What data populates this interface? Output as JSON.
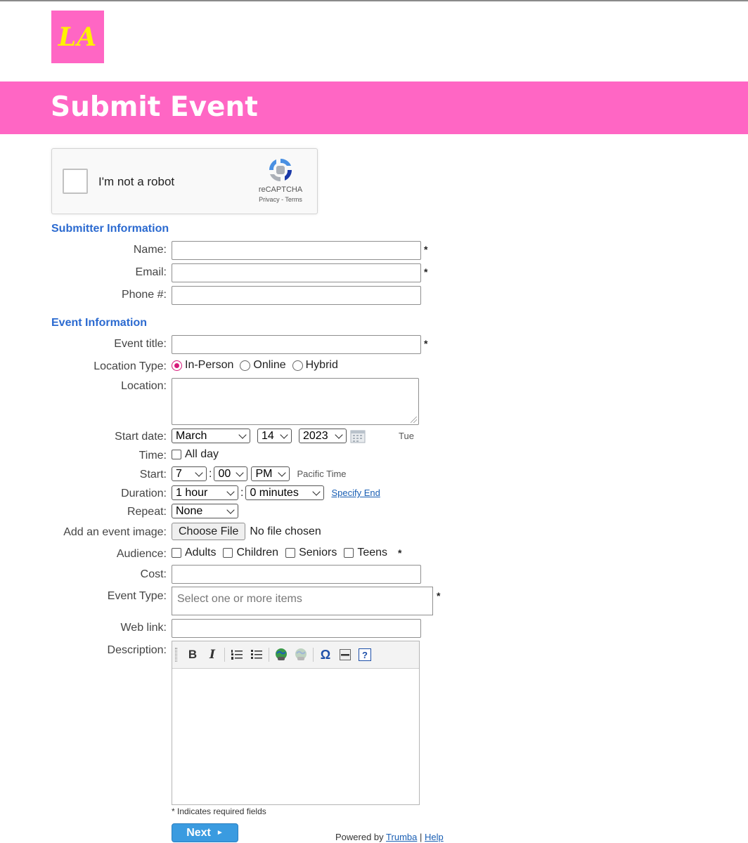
{
  "logo": {
    "text": "LA",
    "bg": "#ff66c4",
    "fg": "#fff200"
  },
  "banner": {
    "title": "Submit Event",
    "bg": "#ff66c4"
  },
  "captcha": {
    "label": "I'm not a robot",
    "brand": "reCAPTCHA",
    "privacy": "Privacy",
    "sep": " - ",
    "terms": "Terms"
  },
  "submitter": {
    "heading": "Submitter Information",
    "name_label": "Name:",
    "email_label": "Email:",
    "phone_label": "Phone #:",
    "required_mark": "*"
  },
  "event": {
    "heading": "Event Information",
    "title_label": "Event title:",
    "location_type_label": "Location Type:",
    "location_types": [
      "In-Person",
      "Online",
      "Hybrid"
    ],
    "location_type_selected": "In-Person",
    "location_label": "Location:",
    "start_date_label": "Start date:",
    "month": "March",
    "day": "14",
    "year": "2023",
    "weekday": "Tue",
    "time_label": "Time:",
    "all_day": "All day",
    "start_label": "Start:",
    "start_hour": "7",
    "start_minute": "00",
    "start_ampm": "PM",
    "timezone": "Pacific Time",
    "duration_label": "Duration:",
    "duration_hours": "1 hour",
    "duration_minutes": "0 minutes",
    "specify_end": "Specify End",
    "repeat_label": "Repeat:",
    "repeat_value": "None",
    "image_label": "Add an event image:",
    "choose_file": "Choose File",
    "no_file": "No file chosen",
    "audience_label": "Audience:",
    "audiences": [
      "Adults",
      "Children",
      "Seniors",
      "Teens"
    ],
    "cost_label": "Cost:",
    "event_type_label": "Event Type:",
    "event_type_placeholder": "Select one or more items",
    "web_link_label": "Web link:",
    "description_label": "Description:"
  },
  "footer": {
    "required_note": "* Indicates required fields",
    "next_label": "Next",
    "powered_by": "Powered by",
    "trumba": "Trumba",
    "pipe": "|",
    "help": "Help"
  },
  "colors": {
    "accent": "#ff66c4",
    "heading_blue": "#2b6ad0",
    "button_blue": "#3a9be0",
    "radio_pink": "#d6197a"
  }
}
